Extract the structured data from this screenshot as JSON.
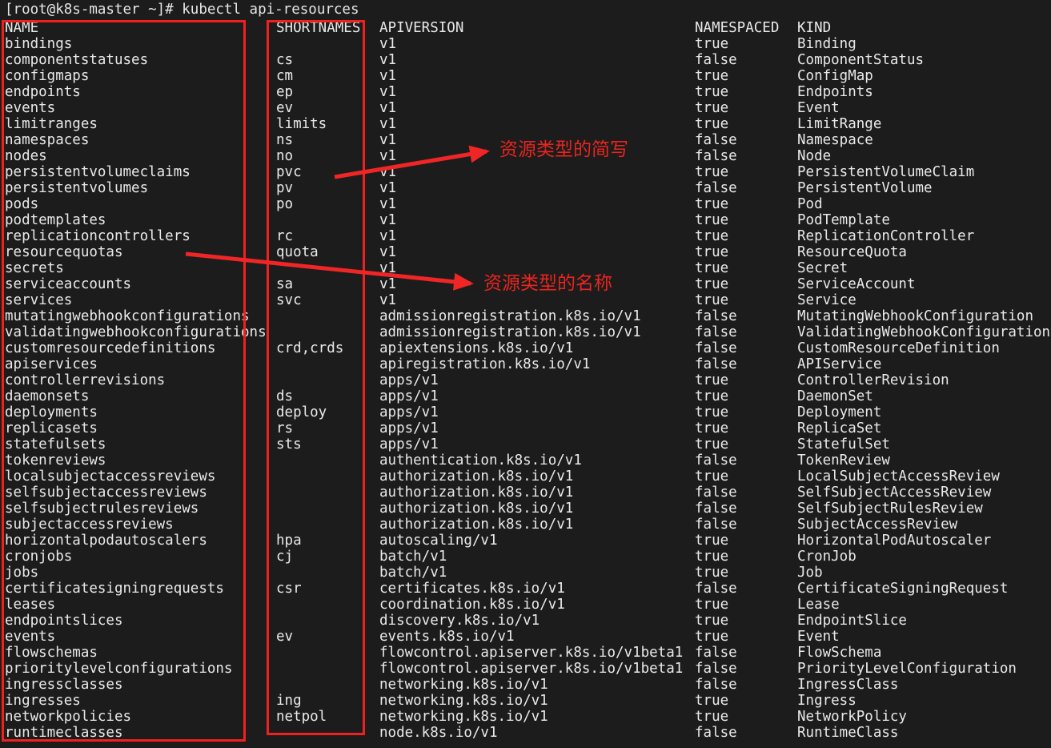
{
  "terminal": {
    "prompt": "[root@k8s-master ~]# kubectl api-resources",
    "colors": {
      "background": "#1c1c1c",
      "foreground": "#e9e9e9",
      "annotation_red": "#e8251f",
      "box_red": "#f02020"
    },
    "columns": {
      "name": "NAME",
      "shortnames": "SHORTNAMES",
      "apiversion": "APIVERSION",
      "namespaced": "NAMESPACED",
      "kind": "KIND"
    },
    "rows": [
      {
        "name": "bindings",
        "short": "",
        "api": "v1",
        "ns": "true",
        "kind": "Binding"
      },
      {
        "name": "componentstatuses",
        "short": "cs",
        "api": "v1",
        "ns": "false",
        "kind": "ComponentStatus"
      },
      {
        "name": "configmaps",
        "short": "cm",
        "api": "v1",
        "ns": "true",
        "kind": "ConfigMap"
      },
      {
        "name": "endpoints",
        "short": "ep",
        "api": "v1",
        "ns": "true",
        "kind": "Endpoints"
      },
      {
        "name": "events",
        "short": "ev",
        "api": "v1",
        "ns": "true",
        "kind": "Event"
      },
      {
        "name": "limitranges",
        "short": "limits",
        "api": "v1",
        "ns": "true",
        "kind": "LimitRange"
      },
      {
        "name": "namespaces",
        "short": "ns",
        "api": "v1",
        "ns": "false",
        "kind": "Namespace"
      },
      {
        "name": "nodes",
        "short": "no",
        "api": "v1",
        "ns": "false",
        "kind": "Node"
      },
      {
        "name": "persistentvolumeclaims",
        "short": "pvc",
        "api": "v1",
        "ns": "true",
        "kind": "PersistentVolumeClaim"
      },
      {
        "name": "persistentvolumes",
        "short": "pv",
        "api": "v1",
        "ns": "false",
        "kind": "PersistentVolume"
      },
      {
        "name": "pods",
        "short": "po",
        "api": "v1",
        "ns": "true",
        "kind": "Pod"
      },
      {
        "name": "podtemplates",
        "short": "",
        "api": "v1",
        "ns": "true",
        "kind": "PodTemplate"
      },
      {
        "name": "replicationcontrollers",
        "short": "rc",
        "api": "v1",
        "ns": "true",
        "kind": "ReplicationController"
      },
      {
        "name": "resourcequotas",
        "short": "quota",
        "api": "v1",
        "ns": "true",
        "kind": "ResourceQuota"
      },
      {
        "name": "secrets",
        "short": "",
        "api": "v1",
        "ns": "true",
        "kind": "Secret"
      },
      {
        "name": "serviceaccounts",
        "short": "sa",
        "api": "v1",
        "ns": "true",
        "kind": "ServiceAccount"
      },
      {
        "name": "services",
        "short": "svc",
        "api": "v1",
        "ns": "true",
        "kind": "Service"
      },
      {
        "name": "mutatingwebhookconfigurations",
        "short": "",
        "api": "admissionregistration.k8s.io/v1",
        "ns": "false",
        "kind": "MutatingWebhookConfiguration"
      },
      {
        "name": "validatingwebhookconfigurations",
        "short": "",
        "api": "admissionregistration.k8s.io/v1",
        "ns": "false",
        "kind": "ValidatingWebhookConfiguration"
      },
      {
        "name": "customresourcedefinitions",
        "short": "crd,crds",
        "api": "apiextensions.k8s.io/v1",
        "ns": "false",
        "kind": "CustomResourceDefinition"
      },
      {
        "name": "apiservices",
        "short": "",
        "api": "apiregistration.k8s.io/v1",
        "ns": "false",
        "kind": "APIService"
      },
      {
        "name": "controllerrevisions",
        "short": "",
        "api": "apps/v1",
        "ns": "true",
        "kind": "ControllerRevision"
      },
      {
        "name": "daemonsets",
        "short": "ds",
        "api": "apps/v1",
        "ns": "true",
        "kind": "DaemonSet"
      },
      {
        "name": "deployments",
        "short": "deploy",
        "api": "apps/v1",
        "ns": "true",
        "kind": "Deployment"
      },
      {
        "name": "replicasets",
        "short": "rs",
        "api": "apps/v1",
        "ns": "true",
        "kind": "ReplicaSet"
      },
      {
        "name": "statefulsets",
        "short": "sts",
        "api": "apps/v1",
        "ns": "true",
        "kind": "StatefulSet"
      },
      {
        "name": "tokenreviews",
        "short": "",
        "api": "authentication.k8s.io/v1",
        "ns": "false",
        "kind": "TokenReview"
      },
      {
        "name": "localsubjectaccessreviews",
        "short": "",
        "api": "authorization.k8s.io/v1",
        "ns": "true",
        "kind": "LocalSubjectAccessReview"
      },
      {
        "name": "selfsubjectaccessreviews",
        "short": "",
        "api": "authorization.k8s.io/v1",
        "ns": "false",
        "kind": "SelfSubjectAccessReview"
      },
      {
        "name": "selfsubjectrulesreviews",
        "short": "",
        "api": "authorization.k8s.io/v1",
        "ns": "false",
        "kind": "SelfSubjectRulesReview"
      },
      {
        "name": "subjectaccessreviews",
        "short": "",
        "api": "authorization.k8s.io/v1",
        "ns": "false",
        "kind": "SubjectAccessReview"
      },
      {
        "name": "horizontalpodautoscalers",
        "short": "hpa",
        "api": "autoscaling/v1",
        "ns": "true",
        "kind": "HorizontalPodAutoscaler"
      },
      {
        "name": "cronjobs",
        "short": "cj",
        "api": "batch/v1",
        "ns": "true",
        "kind": "CronJob"
      },
      {
        "name": "jobs",
        "short": "",
        "api": "batch/v1",
        "ns": "true",
        "kind": "Job"
      },
      {
        "name": "certificatesigningrequests",
        "short": "csr",
        "api": "certificates.k8s.io/v1",
        "ns": "false",
        "kind": "CertificateSigningRequest"
      },
      {
        "name": "leases",
        "short": "",
        "api": "coordination.k8s.io/v1",
        "ns": "true",
        "kind": "Lease"
      },
      {
        "name": "endpointslices",
        "short": "",
        "api": "discovery.k8s.io/v1",
        "ns": "true",
        "kind": "EndpointSlice"
      },
      {
        "name": "events",
        "short": "ev",
        "api": "events.k8s.io/v1",
        "ns": "true",
        "kind": "Event"
      },
      {
        "name": "flowschemas",
        "short": "",
        "api": "flowcontrol.apiserver.k8s.io/v1beta1",
        "ns": "false",
        "kind": "FlowSchema"
      },
      {
        "name": "prioritylevelconfigurations",
        "short": "",
        "api": "flowcontrol.apiserver.k8s.io/v1beta1",
        "ns": "false",
        "kind": "PriorityLevelConfiguration"
      },
      {
        "name": "ingressclasses",
        "short": "",
        "api": "networking.k8s.io/v1",
        "ns": "false",
        "kind": "IngressClass"
      },
      {
        "name": "ingresses",
        "short": "ing",
        "api": "networking.k8s.io/v1",
        "ns": "true",
        "kind": "Ingress"
      },
      {
        "name": "networkpolicies",
        "short": "netpol",
        "api": "networking.k8s.io/v1",
        "ns": "true",
        "kind": "NetworkPolicy"
      },
      {
        "name": "runtimeclasses",
        "short": "",
        "api": "node.k8s.io/v1",
        "ns": "false",
        "kind": "RuntimeClass"
      }
    ]
  },
  "annotations": {
    "shortnames_label": "资源类型的简写",
    "names_label": "资源类型的名称"
  }
}
